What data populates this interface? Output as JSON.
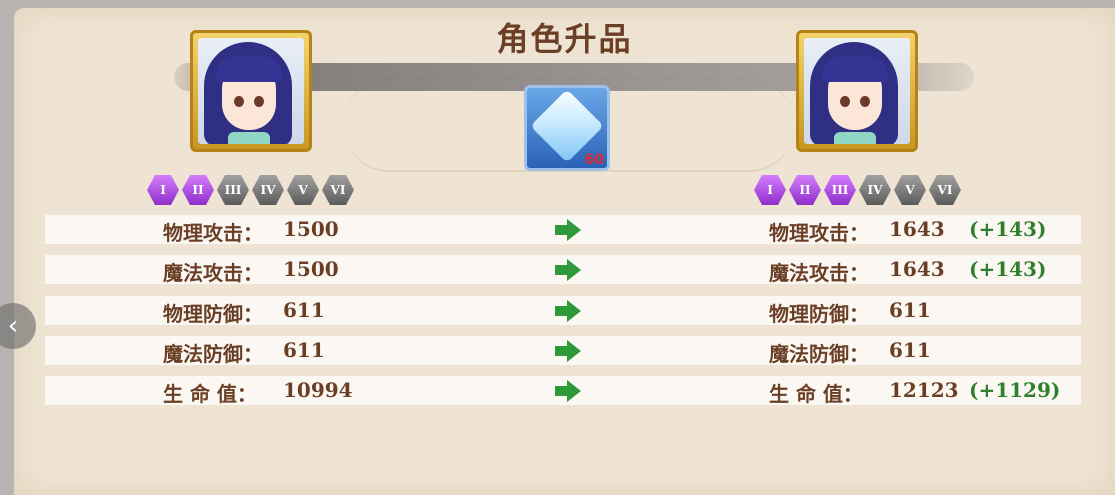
{
  "title": "角色升品",
  "left": {
    "ranks": [
      {
        "label": "I",
        "on": true
      },
      {
        "label": "II",
        "on": true
      },
      {
        "label": "III",
        "on": false
      },
      {
        "label": "IV",
        "on": false
      },
      {
        "label": "V",
        "on": false
      },
      {
        "label": "VI",
        "on": false
      }
    ]
  },
  "right": {
    "ranks": [
      {
        "label": "I",
        "on": true
      },
      {
        "label": "II",
        "on": true
      },
      {
        "label": "III",
        "on": true
      },
      {
        "label": "IV",
        "on": false
      },
      {
        "label": "V",
        "on": false
      },
      {
        "label": "VI",
        "on": false
      }
    ]
  },
  "material": {
    "count": "60",
    "icon": "crystal-icon"
  },
  "stats": [
    {
      "label": "物理攻击：",
      "before": "1500",
      "after_label": "物理攻击：",
      "after": "1643",
      "bonus": "(+143)"
    },
    {
      "label": "魔法攻击：",
      "before": "1500",
      "after_label": "魔法攻击：",
      "after": "1643",
      "bonus": "(+143)"
    },
    {
      "label": "物理防御：",
      "before": "611",
      "after_label": "物理防御：",
      "after": "611",
      "bonus": ""
    },
    {
      "label": "魔法防御：",
      "before": "611",
      "after_label": "魔法防御：",
      "after": "611",
      "bonus": ""
    },
    {
      "label": "生 命 值：",
      "before": "10994",
      "after_label": "生 命 值：",
      "after": "12123",
      "bonus": "(+1129)"
    }
  ],
  "nav": {
    "back": "‹"
  },
  "colors": {
    "label": "#6b3f26",
    "bonus": "#2f7f2e",
    "arrow": "#2f9a3b",
    "rank_on": "#b454ee",
    "rank_off": "#7a7a7a"
  }
}
